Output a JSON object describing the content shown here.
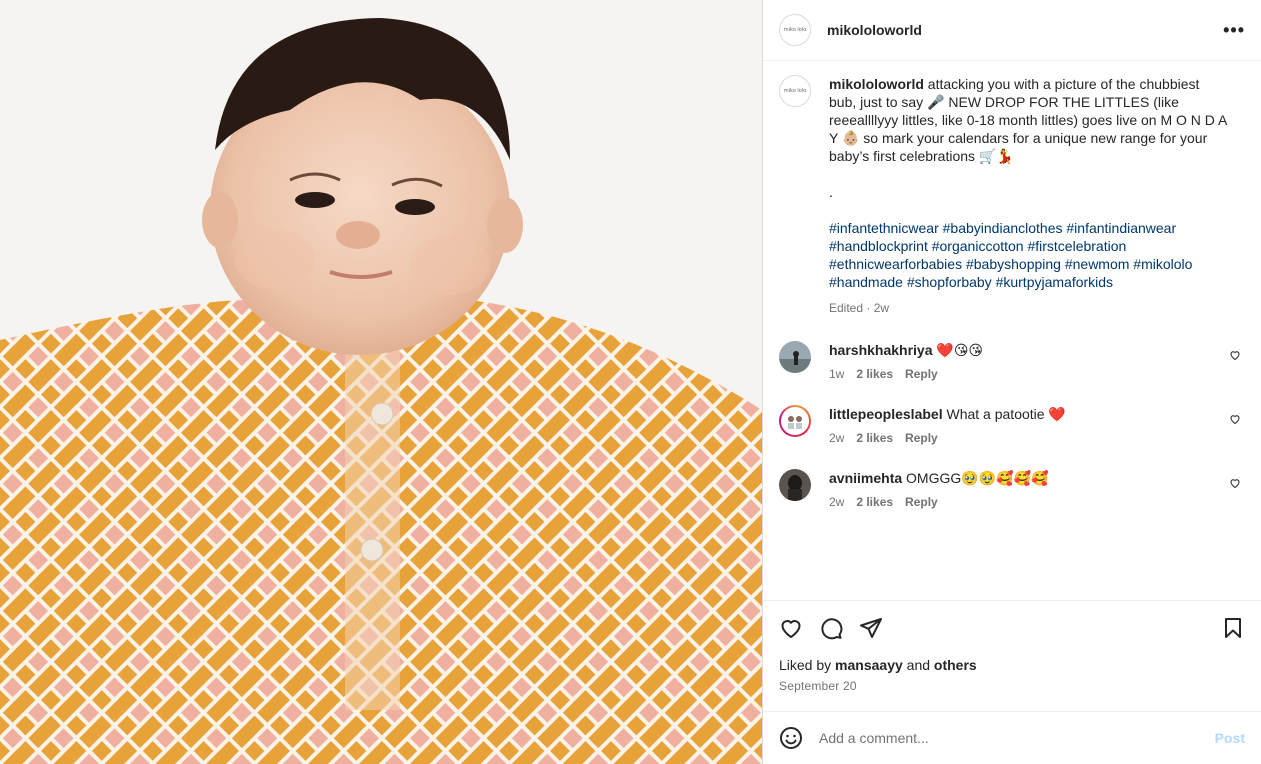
{
  "post": {
    "username": "mikololoworld",
    "avatar_text": "miko lolo",
    "more_label": "•••"
  },
  "caption": {
    "username": "mikololoworld",
    "text": "attacking you with a picture of the chubbiest bub, just to say 🎤 NEW DROP FOR THE LITTLES (like reeeallllyyy littles, like 0-18 month littles) goes live on M O N D A Y 👶🏼 so mark your calendars for a unique new range for your baby’s first celebrations 🛒💃",
    "dot": ".",
    "hashtags": "#infantethnicwear #babyindianclothes #infantindianwear #handblockprint #organiccotton #firstcelebration #ethnicwearforbabies #babyshopping #newmom #mikololo #handmade #shopforbaby #kurtpyjamaforkids",
    "meta": "Edited · 2w"
  },
  "comments": [
    {
      "username": "harshkhakhriya",
      "text": "❤️😘😘",
      "time": "1w",
      "likes": "2 likes",
      "reply": "Reply"
    },
    {
      "username": "littlepeopleslabel",
      "text": "What a patootie ❤️",
      "time": "2w",
      "likes": "2 likes",
      "reply": "Reply"
    },
    {
      "username": "avniimehta",
      "text": "OMGGG🥹🥹🥰🥰🥰",
      "time": "2w",
      "likes": "2 likes",
      "reply": "Reply"
    }
  ],
  "actions": {
    "liked_prefix": "Liked by",
    "liked_user": "mansaayy",
    "liked_and": "and",
    "liked_others": "others",
    "date": "September 20"
  },
  "add_comment": {
    "placeholder": "Add a comment...",
    "post_label": "Post"
  },
  "colors": {
    "hashtag": "#00376b",
    "post_disabled": "#b3dbff",
    "kurta_orange": "#e8a23a",
    "kurta_pink": "#f0b0a0"
  },
  "icons": [
    "more-icon",
    "heart-icon",
    "comment-icon",
    "share-icon",
    "bookmark-icon",
    "emoji-icon",
    "heart-small-icon"
  ]
}
